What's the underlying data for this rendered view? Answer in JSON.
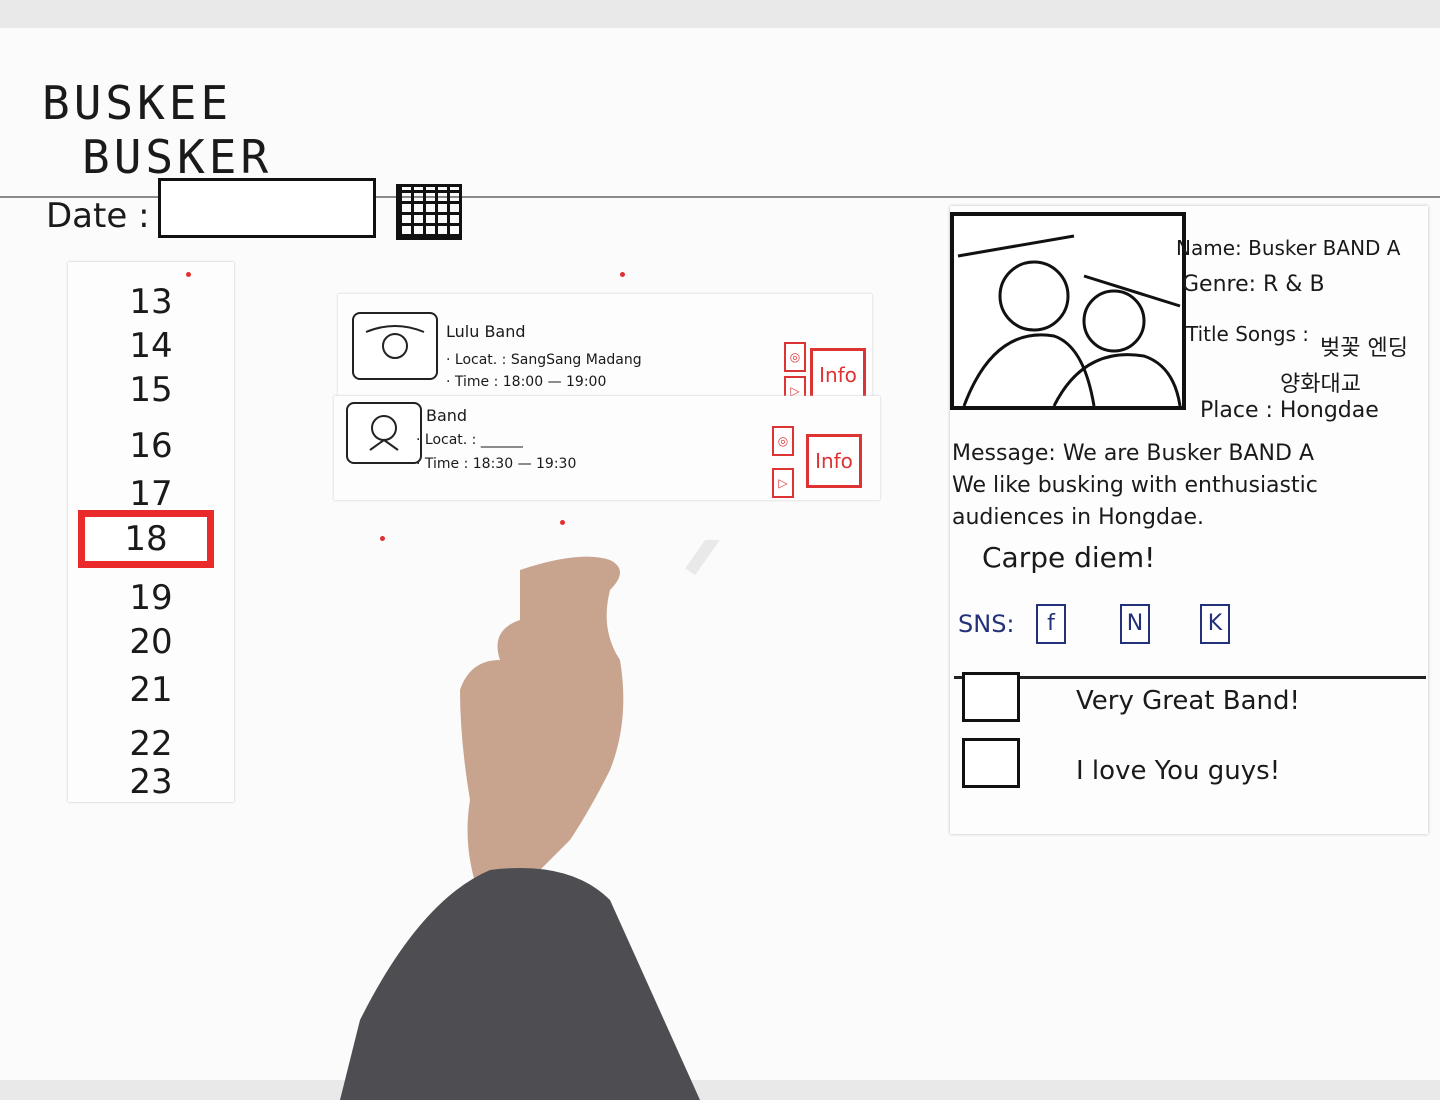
{
  "app": {
    "title_line1": "BUSKEE",
    "title_line2": "BUSKER"
  },
  "date_filter": {
    "label": "Date :",
    "value": ""
  },
  "hours": [
    "13",
    "14",
    "15",
    "16",
    "17",
    "18",
    "19",
    "20",
    "21",
    "22",
    "23"
  ],
  "selected_hour": "18",
  "bands": [
    {
      "name": "Lulu Band",
      "location": "· Locat. : SangSang Madang",
      "time": "· Time : 18:00 — 19:00",
      "like_icon": "badge-icon",
      "play_icon": "play-icon",
      "info_label": "Info"
    },
    {
      "name": "Band",
      "location": "· Locat. : ______",
      "time": "· Time : 18:30 — 19:30",
      "like_icon": "badge-icon",
      "play_icon": "play-icon",
      "info_label": "Info"
    }
  ],
  "detail": {
    "name": "Name: Busker BAND A",
    "genre": "Genre: R & B",
    "title_songs_label": "Title Songs :",
    "song_1": "벚꽃 엔딩",
    "song_2": "양화대교",
    "place": "Place : Hongdae",
    "message_line1": "Message: We are Busker BAND A",
    "message_line2": "We like busking with enthusiastic",
    "message_line3": "audiences in Hongdae.",
    "message_line4": "Carpe diem!",
    "sns_label": "SNS:",
    "sns": [
      "f",
      "N",
      "K"
    ],
    "comments": [
      {
        "text": "Very Great Band!"
      },
      {
        "text": "I love You guys!"
      }
    ]
  },
  "colors": {
    "accent": "#ea2a2a",
    "sns": "#23307a",
    "ink": "#1a1a1a",
    "paper": "#fbfbfb"
  }
}
